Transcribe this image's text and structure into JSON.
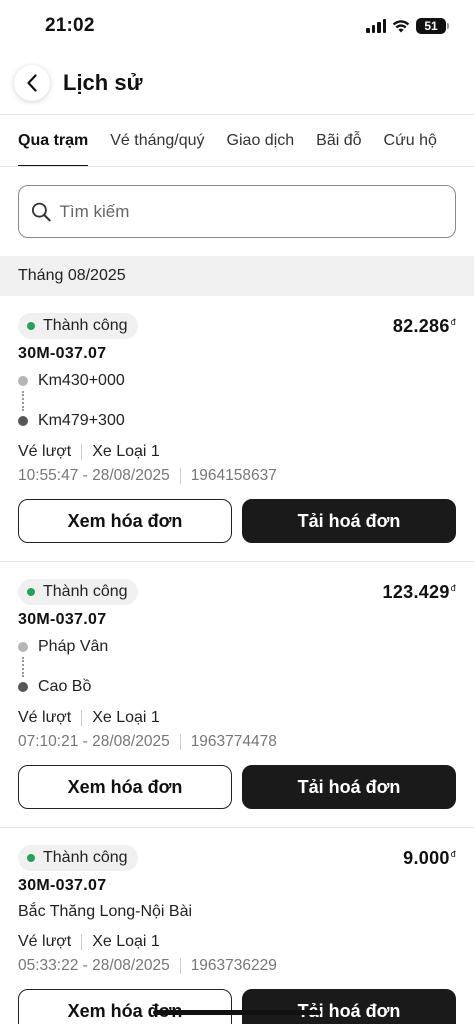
{
  "status_bar": {
    "time": "21:02",
    "battery": "51"
  },
  "header": {
    "title": "Lịch sử"
  },
  "tabs": [
    {
      "label": "Qua trạm",
      "active": true
    },
    {
      "label": "Vé tháng/quý",
      "active": false
    },
    {
      "label": "Giao dịch",
      "active": false
    },
    {
      "label": "Bãi đỗ",
      "active": false
    },
    {
      "label": "Cứu hộ",
      "active": false
    }
  ],
  "search": {
    "placeholder": "Tìm kiếm"
  },
  "month": "Tháng 08/2025",
  "colors": {
    "success_dot": "#22a35a",
    "primary_button": "#1a1a1a"
  },
  "transactions": [
    {
      "status": "Thành công",
      "amount": "82.286",
      "currency": "đ",
      "plate": "30M-037.07",
      "from": "Km430+000",
      "to": "Km479+300",
      "ticket_type": "Vé lượt",
      "vehicle_class": "Xe Loại 1",
      "datetime": "10:55:47 - 28/08/2025",
      "code": "1964158637",
      "view_invoice": "Xem hóa đơn",
      "download_invoice": "Tải hoá đơn"
    },
    {
      "status": "Thành công",
      "amount": "123.429",
      "currency": "đ",
      "plate": "30M-037.07",
      "from": "Pháp Vân",
      "to": "Cao Bồ",
      "ticket_type": "Vé lượt",
      "vehicle_class": "Xe Loại 1",
      "datetime": "07:10:21 - 28/08/2025",
      "code": "1963774478",
      "view_invoice": "Xem hóa đơn",
      "download_invoice": "Tải hoá đơn"
    },
    {
      "status": "Thành công",
      "amount": "9.000",
      "currency": "đ",
      "plate": "30M-037.07",
      "station": "Bắc Thăng Long-Nội Bài",
      "ticket_type": "Vé lượt",
      "vehicle_class": "Xe Loại 1",
      "datetime": "05:33:22 - 28/08/2025",
      "code": "1963736229",
      "view_invoice": "Xem hóa đơn",
      "download_invoice": "Tải hoá đơn"
    }
  ]
}
